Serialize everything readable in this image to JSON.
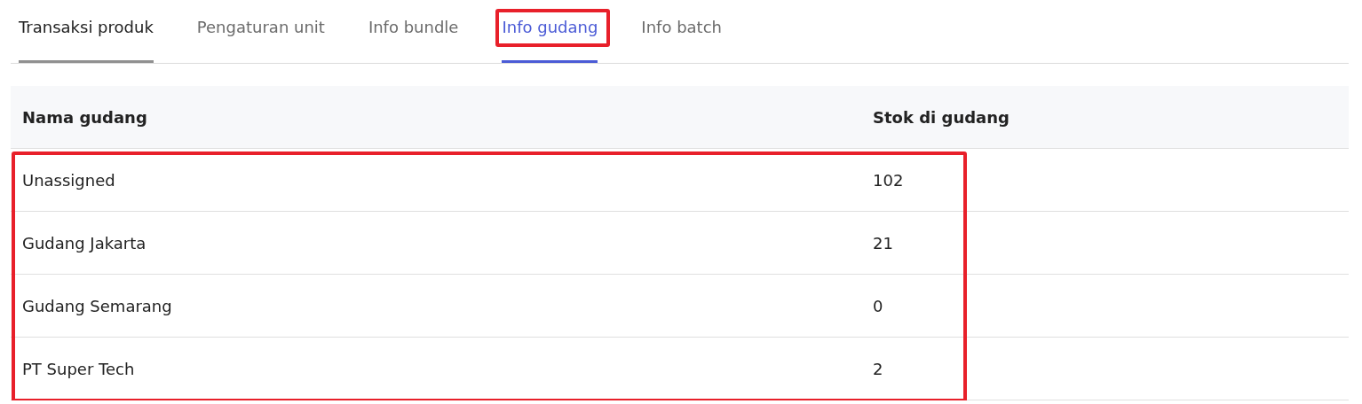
{
  "tabs": [
    {
      "label": "Transaksi produk",
      "selected": false,
      "hovered": true,
      "highlighted": false
    },
    {
      "label": "Pengaturan unit",
      "selected": false,
      "hovered": false,
      "highlighted": false
    },
    {
      "label": "Info bundle",
      "selected": false,
      "hovered": false,
      "highlighted": false
    },
    {
      "label": "Info gudang",
      "selected": true,
      "hovered": false,
      "highlighted": true
    },
    {
      "label": "Info batch",
      "selected": false,
      "hovered": false,
      "highlighted": false
    }
  ],
  "table": {
    "columns": [
      "Nama gudang",
      "Stok di gudang"
    ],
    "rows_highlighted": true,
    "rows": [
      [
        "Unassigned",
        "102"
      ],
      [
        "Gudang Jakarta",
        "21"
      ],
      [
        "Gudang Semarang",
        "0"
      ],
      [
        "PT Super Tech",
        "2"
      ]
    ]
  }
}
